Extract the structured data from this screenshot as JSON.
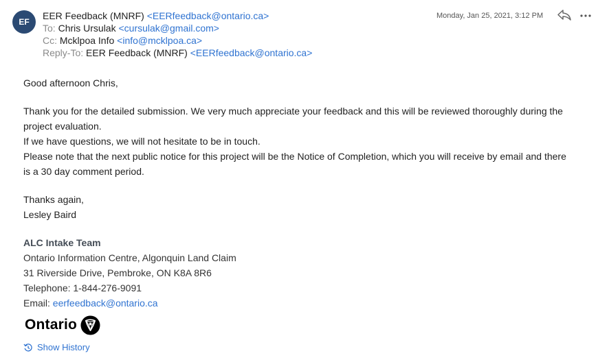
{
  "avatar": {
    "initials": "EF"
  },
  "header": {
    "from_name": "EER Feedback (MNRF)",
    "from_email": "<EERfeedback@ontario.ca>",
    "date": "Monday, Jan 25, 2021, 3:12 PM",
    "to_label": "To:",
    "to_name": "Chris Ursulak",
    "to_email": "<cursulak@gmail.com>",
    "cc_label": "Cc:",
    "cc_name": "Mcklpoa Info",
    "cc_email": "<info@mcklpoa.ca>",
    "replyto_label": "Reply-To:",
    "replyto_name": "EER Feedback (MNRF)",
    "replyto_email": "<EERfeedback@ontario.ca>"
  },
  "actions": {
    "reply_icon": "reply-icon",
    "more_icon": "more-icon"
  },
  "body": {
    "greeting": "Good afternoon Chris,",
    "paragraph1": "Thank you for the detailed submission.  We very much appreciate your feedback and this will be reviewed thoroughly during the project evaluation.",
    "paragraph2": "If we have questions, we will not hesitate to be in touch.",
    "paragraph3": "Please note that the next public notice for this project will be the Notice of Completion, which you will receive by email and there is a 30 day comment period.",
    "thanks": "Thanks again,",
    "sender": "Lesley Baird"
  },
  "signature": {
    "team": "ALC Intake Team",
    "org": "Ontario Information Centre, Algonquin Land Claim",
    "address": "31 Riverside Drive, Pembroke, ON K8A 8R6",
    "phone": "Telephone: 1-844-276-9091",
    "email_label": "Email: ",
    "email": "eerfeedback@ontario.ca"
  },
  "logo": {
    "text": "Ontario",
    "icon": "trillium-logo-icon"
  },
  "footer": {
    "show_history": "Show History",
    "icon": "history-icon"
  },
  "colors": {
    "accent": "#2f73d1",
    "avatar_bg": "#2b4a73"
  }
}
